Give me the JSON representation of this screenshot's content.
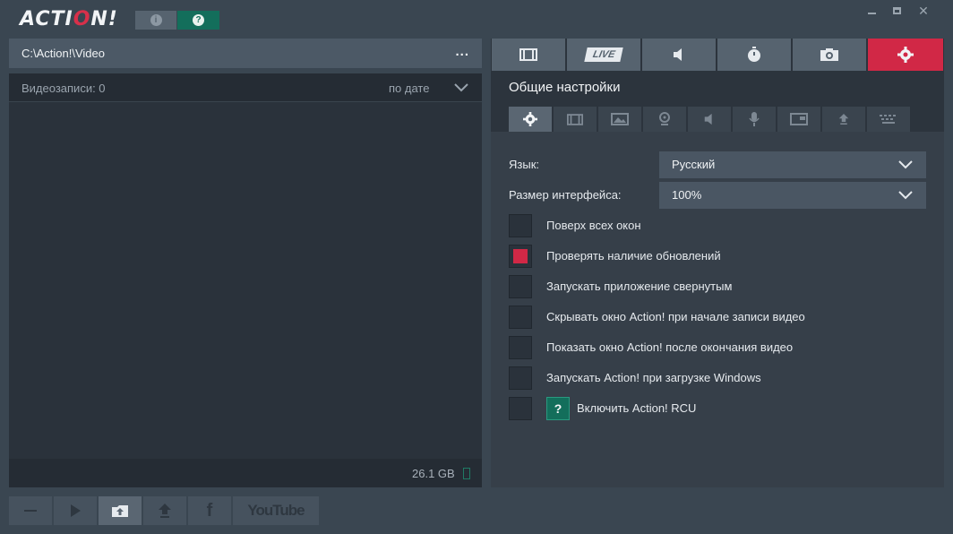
{
  "app": {
    "logo_main": "ACTI",
    "logo_accent": "O",
    "logo_tail": "N!",
    "info_icon": "info-icon",
    "help_icon": "help-icon"
  },
  "left": {
    "path": "C:\\Action!\\Video",
    "browse_label": "...",
    "records_label": "Видеозаписи: 0",
    "sort_label": "по дате",
    "disk_size": "26.1 GB"
  },
  "toolbar": {
    "youtube_label": "YouTube",
    "facebook_label": "f",
    "delete_icon": "minus-icon",
    "play_icon": "play-icon",
    "open_icon": "folder-open-icon",
    "upload_icon": "upload-icon"
  },
  "top_tabs": [
    {
      "icon": "film-icon"
    },
    {
      "icon": "live-icon",
      "label": "LIVE"
    },
    {
      "icon": "speaker-icon"
    },
    {
      "icon": "stopwatch-icon"
    },
    {
      "icon": "camera-icon"
    },
    {
      "icon": "gear-icon",
      "active": true
    }
  ],
  "settings": {
    "section_title": "Общие настройки",
    "language_label": "Язык:",
    "language_value": "Русский",
    "ui_size_label": "Размер интерфейса:",
    "ui_size_value": "100%",
    "options": [
      {
        "label": "Поверх всех окон",
        "checked": false
      },
      {
        "label": "Проверять наличие обновлений",
        "checked": true
      },
      {
        "label": "Запускать приложение свернутым",
        "checked": false
      },
      {
        "label": "Скрывать окно Action! при начале записи видео",
        "checked": false
      },
      {
        "label": "Показать окно Action! после окончания видео",
        "checked": false
      },
      {
        "label": "Запускать Action! при загрузке Windows",
        "checked": false
      },
      {
        "label": "Включить Action! RCU",
        "checked": false
      }
    ],
    "rcu_help": "?"
  },
  "colors": {
    "accent": "#d12846",
    "help_green": "#136e5b"
  }
}
